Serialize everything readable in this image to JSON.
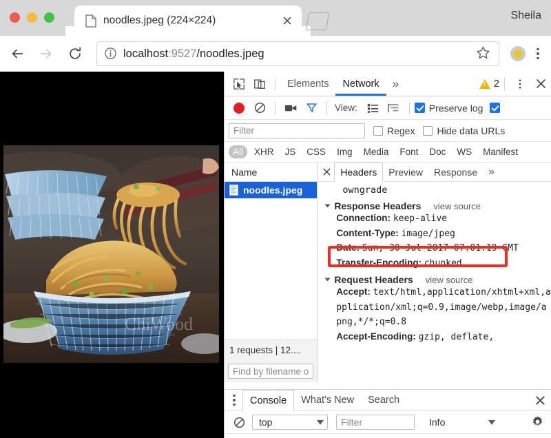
{
  "browser": {
    "tab": {
      "title": "noodles.jpeg (224×224)",
      "favicon_name": "document-icon",
      "close_label": "×"
    },
    "new_tab_label": "+",
    "profile_name": "Sheila",
    "nav": {
      "back_label": "←",
      "forward_label": "→",
      "reload_label": "⟳"
    },
    "omnibox": {
      "scheme_info_icon": "info-icon",
      "host": "localhost",
      "port": ":9527",
      "path": "/noodles.jpeg",
      "full_url": "localhost:9527/noodles.jpeg",
      "bookmark_icon": "star-icon"
    },
    "menu_icon": "kebab-menu-icon",
    "avatar_icon": "profile-avatar"
  },
  "page": {
    "image_alt": "Bowl of noodles with chopsticks",
    "background_color": "#000000"
  },
  "devtools": {
    "main_tabs": [
      {
        "label": "Elements",
        "active": false
      },
      {
        "label": "Network",
        "active": true
      }
    ],
    "more_tabs_label": "»",
    "inspect_icon": "inspect-element-icon",
    "device_icon": "device-toolbar-icon",
    "warnings": {
      "icon": "warning-triangle-icon",
      "count": "2"
    },
    "settings_icon": "kebab-menu-icon",
    "close_icon": "close-icon",
    "network_toolbar": {
      "record_icon": "record-button",
      "clear_icon": "clear-icon",
      "camera_icon": "camera-icon",
      "filter_icon": "funnel-icon",
      "view_label": "View:",
      "list_view_icon": "list-view-icon",
      "waterfall_view_icon": "waterfall-view-icon",
      "preserve_log": {
        "label": "Preserve log",
        "checked": true
      },
      "disable_cache": {
        "label": "",
        "checked": true
      }
    },
    "filter_row": {
      "filter_placeholder": "Filter",
      "filter_value": "",
      "regex": {
        "label": "Regex",
        "checked": false
      },
      "hide_data_urls": {
        "label": "Hide data URLs",
        "checked": false
      }
    },
    "type_filters": [
      {
        "label": "All",
        "active": true
      },
      {
        "label": "XHR",
        "active": false
      },
      {
        "label": "JS",
        "active": false
      },
      {
        "label": "CSS",
        "active": false
      },
      {
        "label": "Img",
        "active": false
      },
      {
        "label": "Media",
        "active": false
      },
      {
        "label": "Font",
        "active": false
      },
      {
        "label": "Doc",
        "active": false
      },
      {
        "label": "WS",
        "active": false
      },
      {
        "label": "Manifest",
        "active": false
      }
    ],
    "request_list": {
      "column_header": "Name",
      "rows": [
        {
          "name": "noodles.jpeg",
          "icon": "file-image-icon",
          "selected": true
        }
      ],
      "summary": "1 requests  |  12....",
      "find_placeholder": "Find by filename o"
    },
    "detail_pane": {
      "close_icon": "close-icon",
      "tabs": [
        {
          "label": "Headers",
          "active": true
        },
        {
          "label": "Preview",
          "active": false
        },
        {
          "label": "Response",
          "active": false
        }
      ],
      "more_tabs_label": "»",
      "continuation_line": "owngrade",
      "sections": [
        {
          "title": "Response Headers",
          "view_source_label": "view source",
          "expanded": true,
          "headers": [
            {
              "key": "Connection:",
              "value": "keep-alive",
              "highlighted": false
            },
            {
              "key": "Content-Type:",
              "value": "image/jpeg",
              "highlighted": true
            },
            {
              "key": "Date:",
              "value": "Sun, 30 Jul 2017 07:01:19 GMT",
              "highlighted": false
            },
            {
              "key": "Transfer-Encoding:",
              "value": "chunked",
              "highlighted": false
            }
          ]
        },
        {
          "title": "Request Headers",
          "view_source_label": "view source",
          "expanded": true,
          "headers": [
            {
              "key": "Accept:",
              "value": "text/html,application/xhtml+xml,application/xml;q=0.9,image/webp,image/apng,*/*;q=0.8",
              "highlighted": false
            },
            {
              "key": "Accept-Encoding:",
              "value": "gzip, deflate,",
              "highlighted": false
            }
          ]
        }
      ],
      "highlight_color": "#ef2b22"
    },
    "drawer": {
      "menu_icon": "kebab-menu-icon",
      "tabs": [
        {
          "label": "Console",
          "active": true
        },
        {
          "label": "What's New",
          "active": false
        },
        {
          "label": "Search",
          "active": false
        }
      ],
      "close_icon": "close-icon",
      "clear_console_icon": "clear-icon",
      "context_select": {
        "value": "top"
      },
      "filter_placeholder": "Filter",
      "level_select": {
        "value": "Info"
      },
      "settings_icon": "gear-icon"
    }
  }
}
